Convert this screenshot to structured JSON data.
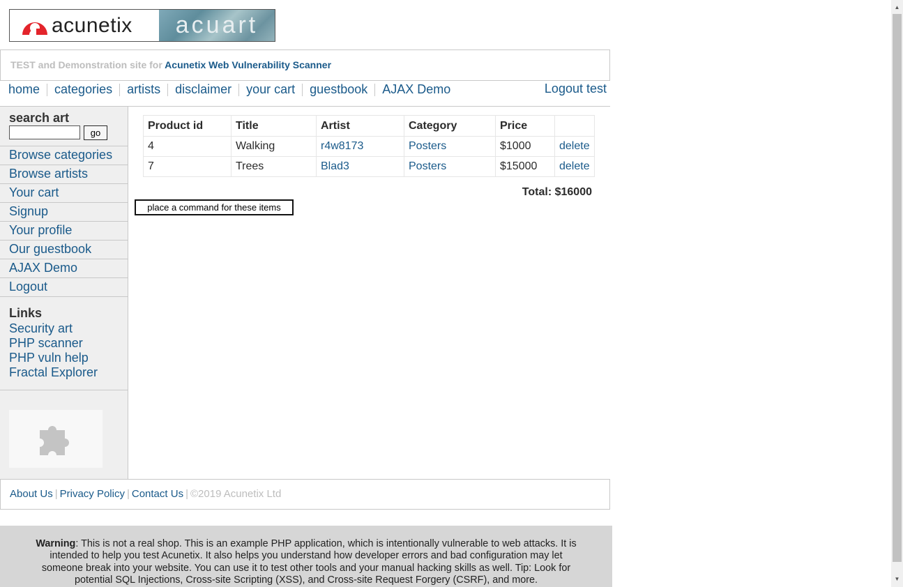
{
  "logo": {
    "brand": "acunetix",
    "product": "acuart"
  },
  "tagline": {
    "prefix": "TEST and Demonstration site for ",
    "brand": "Acunetix Web Vulnerability Scanner"
  },
  "topnav": {
    "items": [
      "home",
      "categories",
      "artists",
      "disclaimer",
      "your cart",
      "guestbook",
      "AJAX Demo"
    ],
    "logout": "Logout test"
  },
  "sidebar": {
    "search_title": "search art",
    "search_value": "",
    "go_label": "go",
    "menu": [
      "Browse categories",
      "Browse artists",
      "Your cart",
      "Signup",
      "Your profile",
      "Our guestbook",
      "AJAX Demo",
      "Logout"
    ],
    "links_title": "Links",
    "links": [
      "Security art",
      "PHP scanner",
      "PHP vuln help",
      "Fractal Explorer"
    ]
  },
  "cart": {
    "headers": [
      "Product id",
      "Title",
      "Artist",
      "Category",
      "Price",
      ""
    ],
    "rows": [
      {
        "id": "4",
        "title": "Walking",
        "artist": "r4w8173",
        "category": "Posters",
        "price": "$1000",
        "action": "delete"
      },
      {
        "id": "7",
        "title": "Trees",
        "artist": "Blad3",
        "category": "Posters",
        "price": "$15000",
        "action": "delete"
      }
    ],
    "total": "Total: $16000",
    "order_button": "place a command for these items"
  },
  "footer": {
    "about": "About Us",
    "privacy": "Privacy Policy",
    "contact": "Contact Us",
    "sep": "|",
    "copyright": "©2019 Acunetix Ltd"
  },
  "warning": {
    "label": "Warning",
    "text": ": This is not a real shop. This is an example PHP application, which is intentionally vulnerable to web attacks. It is intended to help you test Acunetix. It also helps you understand how developer errors and bad configuration may let someone break into your website. You can use it to test other tools and your manual hacking skills as well. Tip: Look for potential SQL Injections, Cross-site Scripting (XSS), and Cross-site Request Forgery (CSRF), and more."
  },
  "colors": {
    "link": "#1a5a8a",
    "sidebar_bg": "#efefef",
    "warning_bg": "#d6d6d6",
    "border": "#c8c8c8"
  }
}
